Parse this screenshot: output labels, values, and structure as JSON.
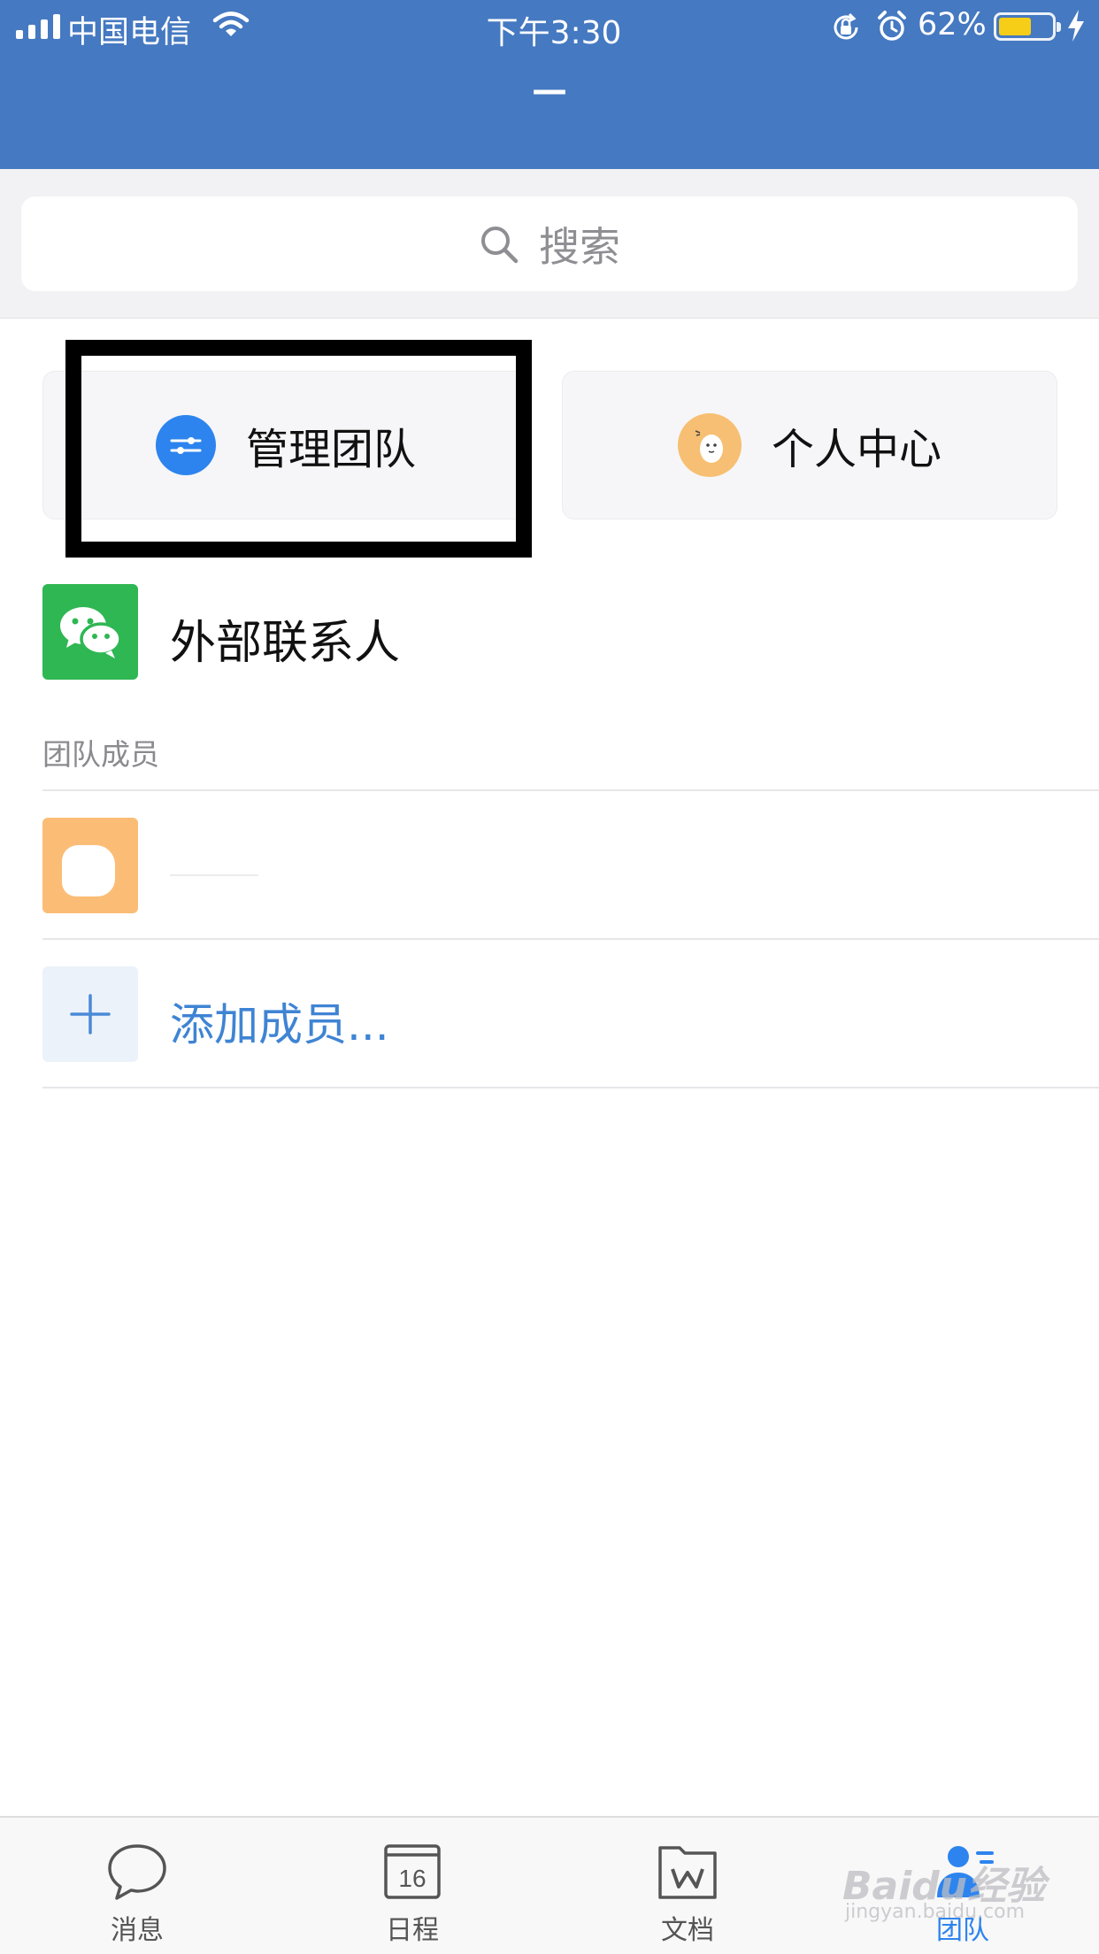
{
  "status_bar": {
    "carrier": "中国电信",
    "time": "下午3:30",
    "battery_percent": "62%",
    "battery_level": 0.62,
    "battery_color": "#f7ce17"
  },
  "header": {
    "title": "—",
    "color": "#4579c1"
  },
  "search": {
    "placeholder": "搜索",
    "icon": "search-icon"
  },
  "cards": {
    "manage_team": {
      "label": "管理团队",
      "icon": "sliders-icon",
      "highlighted": true
    },
    "personal_center": {
      "label": "个人中心",
      "icon": "avatar"
    }
  },
  "external_contacts": {
    "label": "外部联系人",
    "icon": "wechat-icon"
  },
  "members_section": {
    "title": "团队成员",
    "members": [
      {
        "name": "",
        "avatar": "member-avatar"
      }
    ],
    "add_label": "添加成员..."
  },
  "tabbar": {
    "tabs": [
      {
        "label": "消息",
        "icon": "chat-bubble-icon",
        "active": false
      },
      {
        "label": "日程",
        "icon": "calendar-icon",
        "day": "16",
        "active": false
      },
      {
        "label": "文档",
        "icon": "document-folder-icon",
        "active": false
      },
      {
        "label": "团队",
        "icon": "team-icon",
        "active": true
      }
    ],
    "active_color": "#2d84ee"
  },
  "watermark": {
    "text": "Baidu经验",
    "sub": "jingyan.baidu.com"
  }
}
